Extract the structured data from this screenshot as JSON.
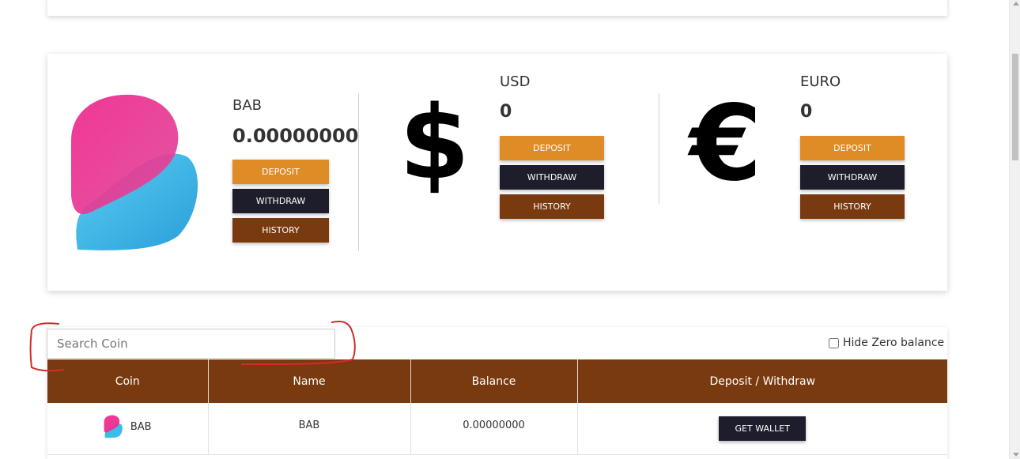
{
  "wallets": {
    "bab": {
      "name": "BAB",
      "amount": "0.00000000",
      "icon": "bab-coin-icon",
      "deposit_label": "DEPOSIT",
      "withdraw_label": "WITHDRAW",
      "history_label": "HISTORY"
    },
    "usd": {
      "name": "USD",
      "amount": "0",
      "symbol": "$",
      "deposit_label": "DEPOSIT",
      "withdraw_label": "WITHDRAW",
      "history_label": "HISTORY"
    },
    "euro": {
      "name": "EURO",
      "amount": "0",
      "symbol": "€",
      "deposit_label": "DEPOSIT",
      "withdraw_label": "WITHDRAW",
      "history_label": "HISTORY"
    }
  },
  "search": {
    "placeholder": "Search Coin"
  },
  "hide_zero": {
    "label": "Hide Zero balance",
    "checked": false
  },
  "table": {
    "headers": [
      "Coin",
      "Name",
      "Balance",
      "Deposit / Withdraw"
    ],
    "rows": [
      {
        "coin": "BAB",
        "name": "BAB",
        "balance": "0.00000000",
        "action_label": "GET WALLET"
      }
    ]
  },
  "colors": {
    "deposit": "#df8c27",
    "withdraw": "#1e1d2b",
    "history": "#7a3a10",
    "table_header": "#7a3a10",
    "annotation": "#d32a2a",
    "logo_pink": "#f0288c",
    "logo_blue": "#2ab3e6"
  }
}
